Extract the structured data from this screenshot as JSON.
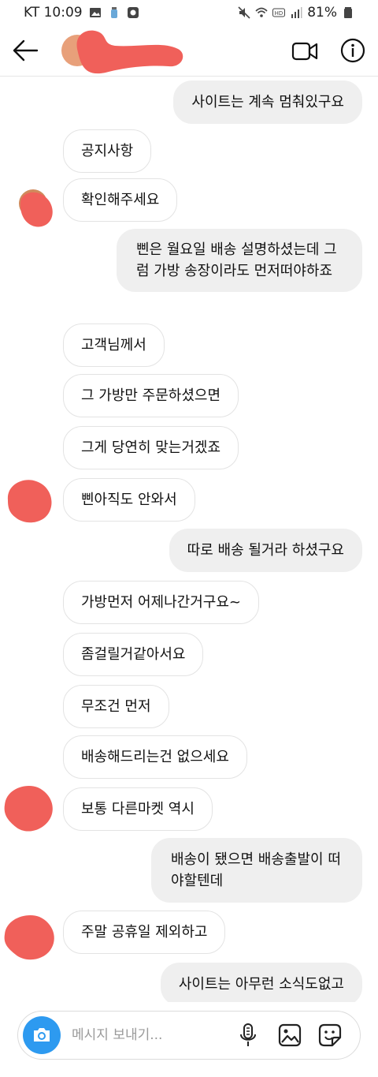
{
  "status_bar": {
    "carrier_time": "KT 10:09",
    "battery": "81%"
  },
  "header": {
    "back_icon": "arrow-left-icon",
    "video_icon": "video-camera-icon",
    "info_icon": "info-icon"
  },
  "messages": [
    {
      "dir": "out",
      "text": "사이트는 계속 멈춰있구요"
    },
    {
      "dir": "in",
      "text": "공지사항"
    },
    {
      "dir": "in",
      "text": "확인해주세요"
    },
    {
      "dir": "out",
      "text": "삔은 월요일 배송 설명하셨는데 그럼 가방 송장이라도 먼저떠야하죠"
    },
    {
      "dir": "in",
      "text": "고객님께서"
    },
    {
      "dir": "in",
      "text": "그 가방만 주문하셨으면"
    },
    {
      "dir": "in",
      "text": "그게 당연히 맞는거겠죠"
    },
    {
      "dir": "in",
      "text": "삔아직도 안와서"
    },
    {
      "dir": "out",
      "text": "따로 배송 될거라 하셨구요"
    },
    {
      "dir": "in",
      "text": "가방먼저 어제나간거구요~"
    },
    {
      "dir": "in",
      "text": "좀걸릴거같아서요"
    },
    {
      "dir": "in",
      "text": "무조건 먼저"
    },
    {
      "dir": "in",
      "text": "배송해드리는건 없으세요"
    },
    {
      "dir": "in",
      "text": "보통 다른마켓 역시"
    },
    {
      "dir": "out",
      "text": "배송이 됐으면 배송출발이 떠야할텐데"
    },
    {
      "dir": "in",
      "text": "주말 공휴일 제외하고"
    },
    {
      "dir": "out",
      "text": "사이트는 아무런 소식도없고"
    }
  ],
  "composer": {
    "placeholder": "메시지 보내기...",
    "camera_icon": "camera-icon",
    "mic_icon": "microphone-icon",
    "gallery_icon": "image-icon",
    "sticker_icon": "sticker-icon"
  },
  "colors": {
    "accent": "#2d9af0",
    "outgoing_bubble": "#efefef",
    "redaction": "#f0605a"
  }
}
